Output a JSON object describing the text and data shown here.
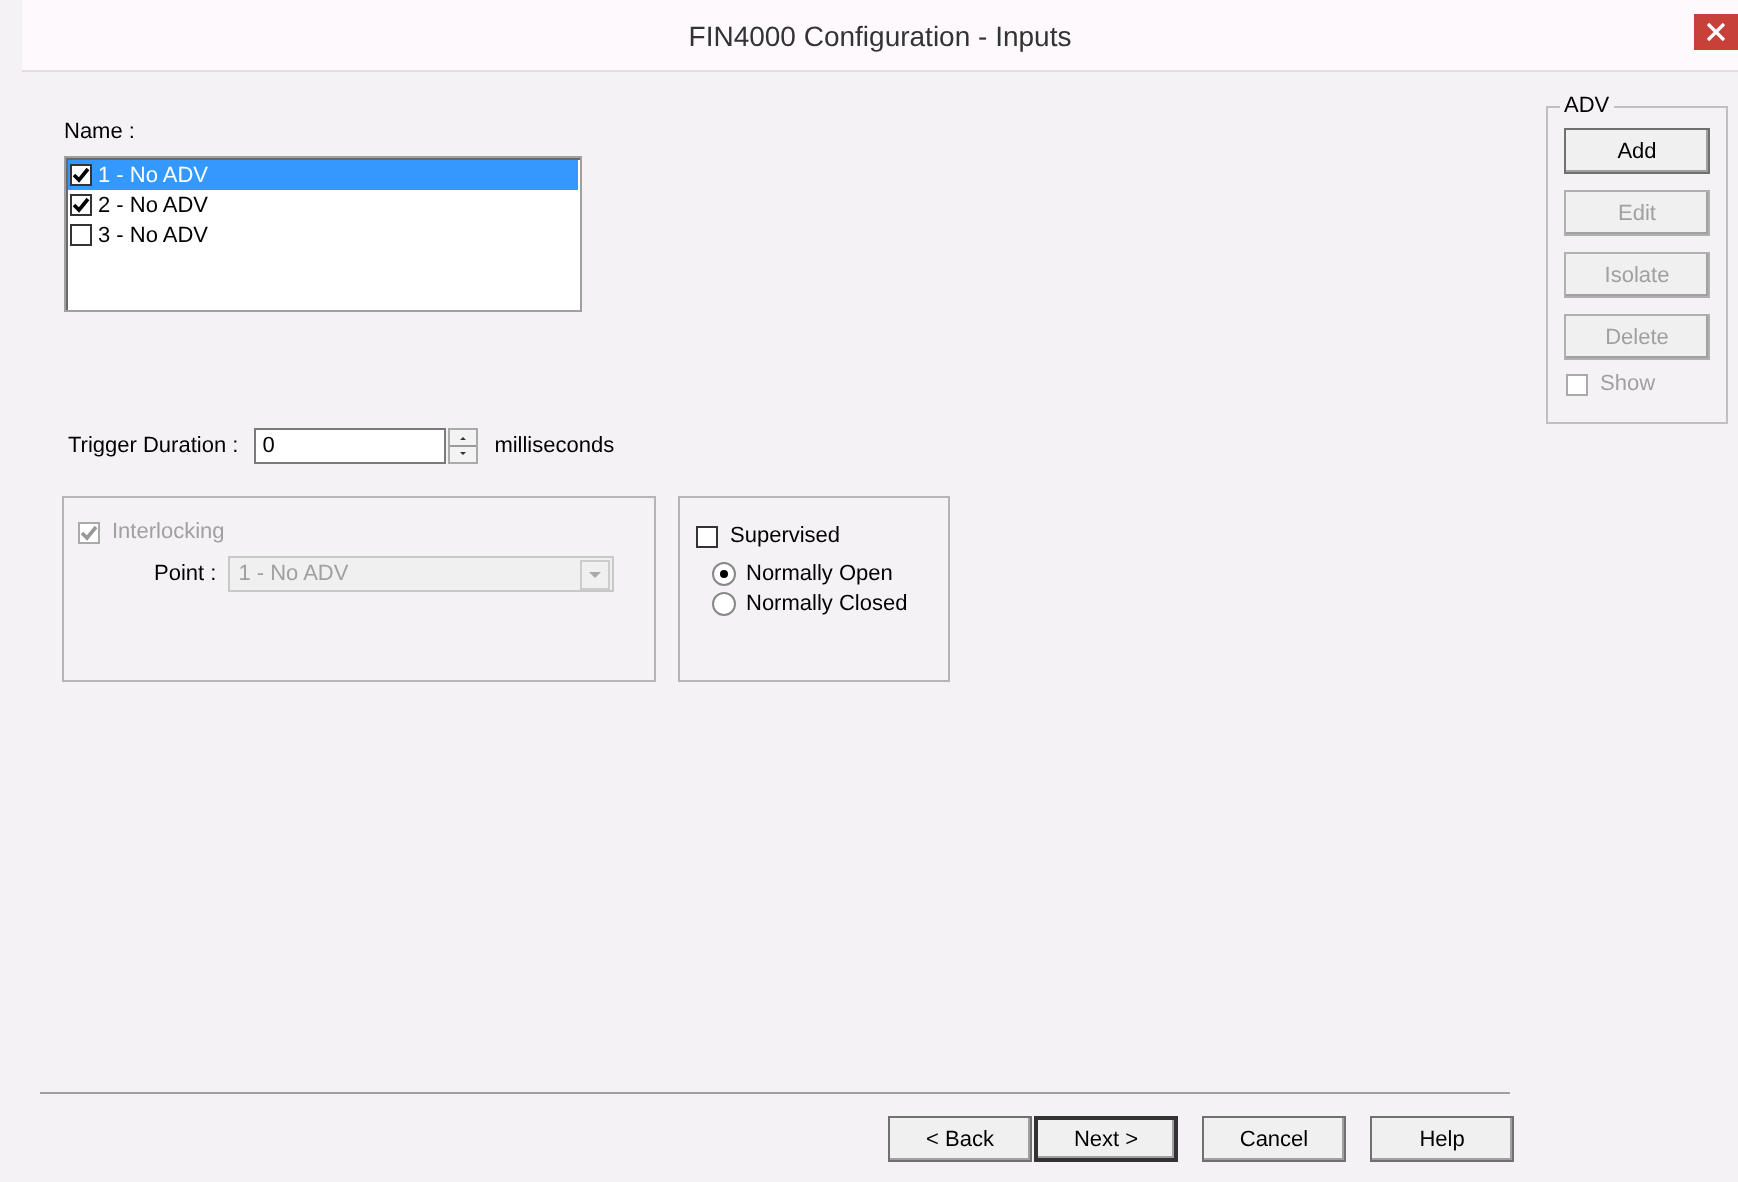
{
  "window": {
    "title": "FIN4000 Configuration - Inputs"
  },
  "name_list": {
    "label": "Name :",
    "items": [
      {
        "label": "1 - No ADV",
        "checked": true,
        "selected": true
      },
      {
        "label": "2 - No ADV",
        "checked": true,
        "selected": false
      },
      {
        "label": "3 - No ADV",
        "checked": false,
        "selected": false
      }
    ]
  },
  "trigger_duration": {
    "label": "Trigger Duration :",
    "value": "0",
    "unit": "milliseconds"
  },
  "interlocking": {
    "label": "Interlocking",
    "checked": true,
    "disabled": true,
    "point_label": "Point :",
    "point_value": "1 - No ADV"
  },
  "supervised": {
    "label": "Supervised",
    "checked": false,
    "options": [
      {
        "label": "Normally Open",
        "selected": true
      },
      {
        "label": "Normally Closed",
        "selected": false
      }
    ]
  },
  "adv": {
    "title": "ADV",
    "buttons": [
      {
        "label": "Add",
        "disabled": false
      },
      {
        "label": "Edit",
        "disabled": true
      },
      {
        "label": "Isolate",
        "disabled": true
      },
      {
        "label": "Delete",
        "disabled": true
      }
    ],
    "show": {
      "label": "Show",
      "checked": false,
      "disabled": true
    }
  },
  "footer_buttons": [
    {
      "label": "< Back",
      "default": false
    },
    {
      "label": "Next >",
      "default": true
    },
    {
      "label": "Cancel",
      "default": false
    },
    {
      "label": "Help",
      "default": false
    }
  ]
}
